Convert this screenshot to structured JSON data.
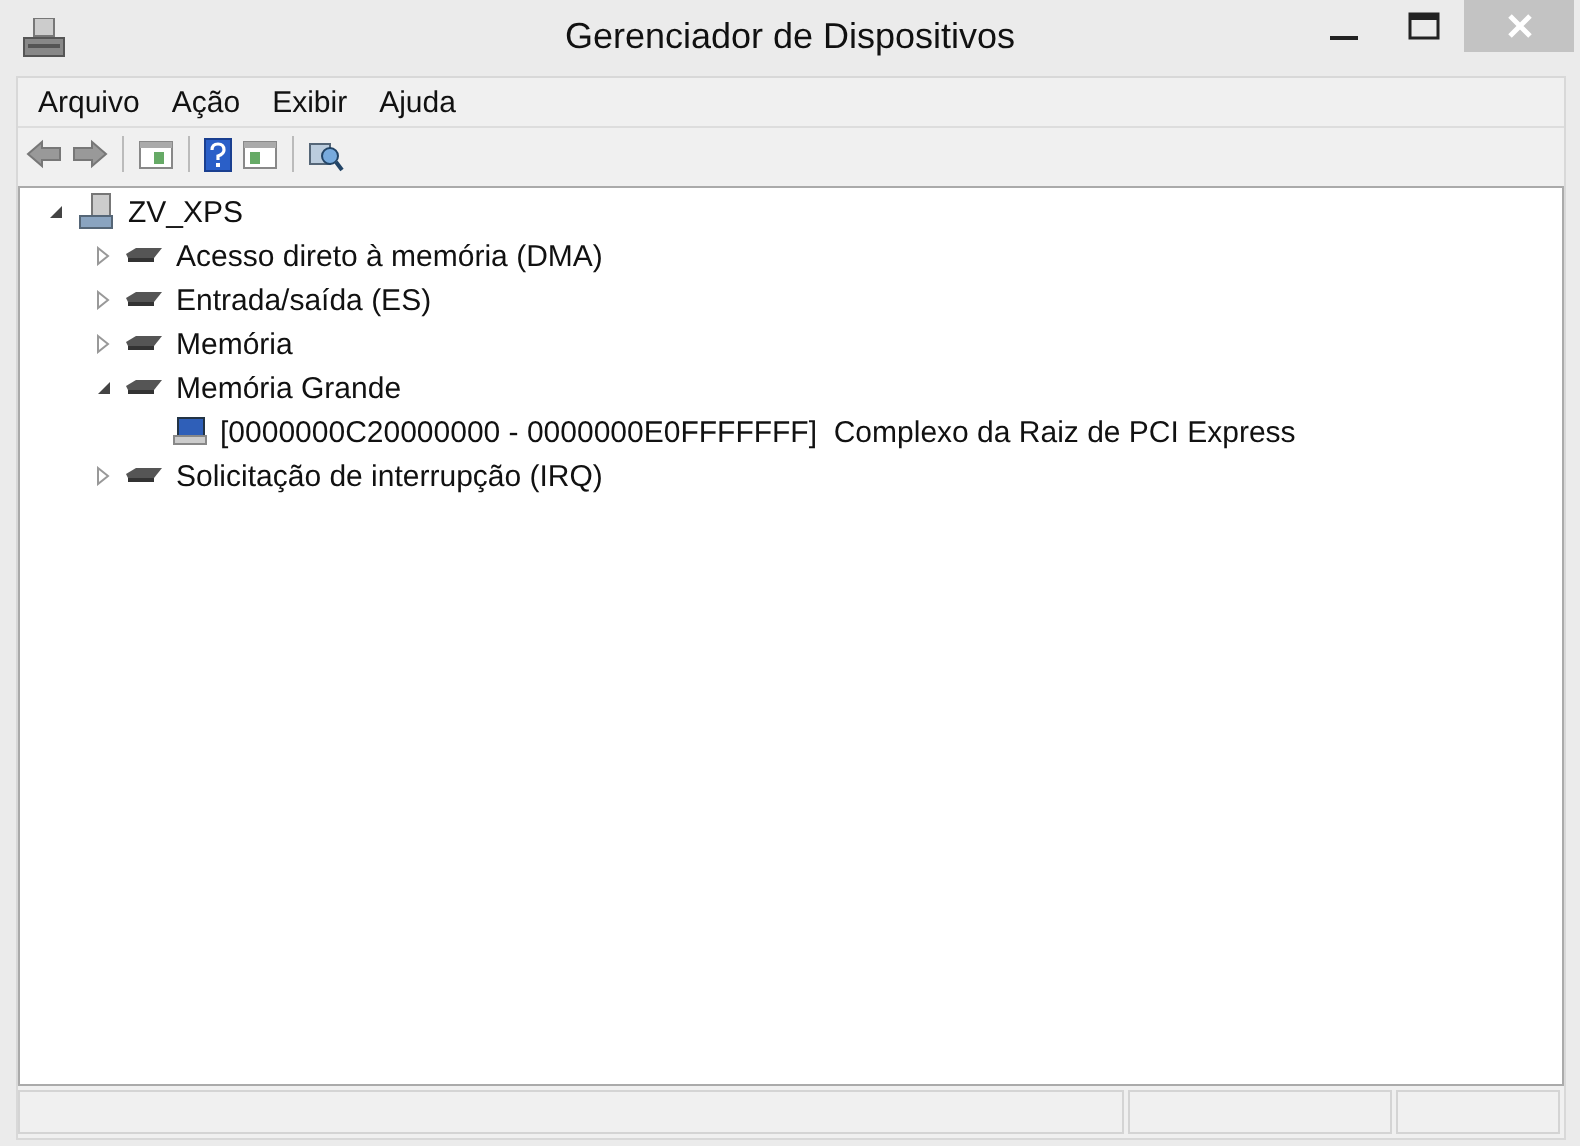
{
  "window": {
    "title": "Gerenciador de Dispositivos"
  },
  "menu": [
    "Arquivo",
    "Ação",
    "Exibir",
    "Ajuda"
  ],
  "tree": [
    {
      "kind": "computer",
      "label": "ZV_XPS",
      "expanded": true,
      "children": [
        {
          "kind": "resource",
          "label": "Acesso direto à memória (DMA)",
          "expanded": false
        },
        {
          "kind": "resource",
          "label": "Entrada/saída (ES)",
          "expanded": false
        },
        {
          "kind": "resource",
          "label": "Memória",
          "expanded": false
        },
        {
          "kind": "resource",
          "label": "Memória Grande",
          "expanded": true,
          "children": [
            {
              "kind": "device",
              "label": "[0000000C20000000 - 0000000E0FFFFFFF]  Complexo da Raiz de PCI Express"
            }
          ]
        },
        {
          "kind": "resource",
          "label": "Solicitação de interrupção (IRQ)",
          "expanded": false
        }
      ]
    }
  ]
}
